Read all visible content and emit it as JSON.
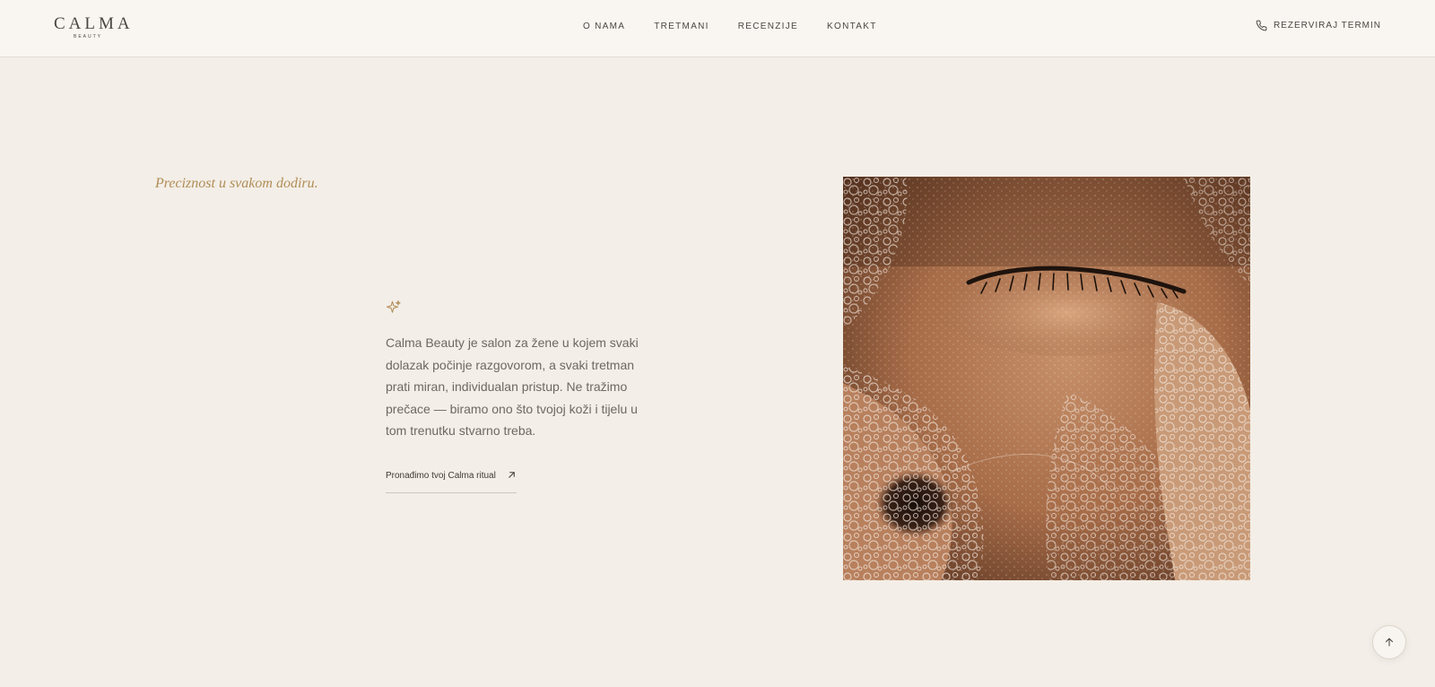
{
  "brand": {
    "name": "CALMA",
    "subname": "BEAUTY"
  },
  "nav": {
    "items": [
      {
        "label": "O NAMA"
      },
      {
        "label": "TRETMANI"
      },
      {
        "label": "RECENZIJE"
      },
      {
        "label": "KONTAKT"
      }
    ]
  },
  "header": {
    "book_label": "REZERVIRAJ TERMIN",
    "book_icon": "phone-icon"
  },
  "hero": {
    "tagline": "Preciznost u svakom dodiru.",
    "sparkle_icon": "sparkle-icon",
    "intro": "Calma Beauty je salon za žene u kojem svaki dolazak počinje razgovorom, a svaki tretman prati miran, individualan pristup. Ne tražimo prečace — biramo ono što tvojoj koži i tijelu u tom trenutku stvarno treba.",
    "cta_label": "Pronađimo tvoj Calma ritual",
    "cta_icon": "arrow-up-right-icon"
  },
  "scroll_top": {
    "icon": "arrow-up-icon"
  },
  "colors": {
    "background": "#f3eee7",
    "header_background": "#f9f6f1",
    "accent_gold": "#b08d57",
    "text": "#4a4540",
    "body_text": "#6d6862"
  }
}
